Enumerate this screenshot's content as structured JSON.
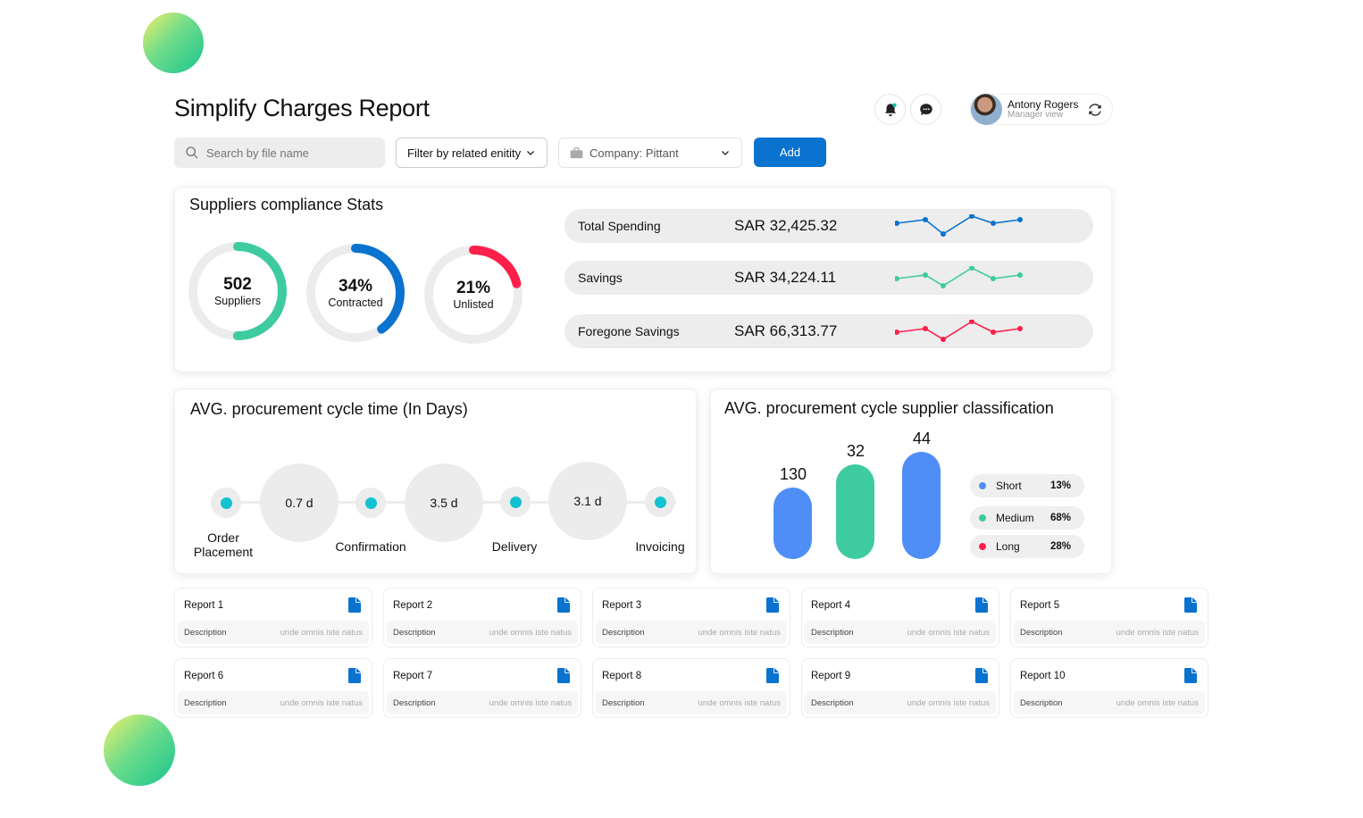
{
  "header": {
    "title": "Simplify Charges Report",
    "user_name": "Antony Rogers",
    "user_role": "Manager view",
    "notification_badge_color": "#13c3a6"
  },
  "filters": {
    "search_placeholder": "Search by file name",
    "entity_filter": "Filter by related enitity",
    "company": "Company: Pittant",
    "add_label": "Add"
  },
  "compliance": {
    "title": "Suppliers compliance Stats",
    "gauges": [
      {
        "value": "502",
        "label": "Suppliers",
        "fill": 0.5,
        "color": "#3ecba0"
      },
      {
        "value": "34%",
        "label": "Contracted",
        "fill": 0.4,
        "color": "#0a72cf"
      },
      {
        "value": "21%",
        "label": "Unlisted",
        "fill": 0.21,
        "color": "#ff1f4b"
      }
    ],
    "stats": [
      {
        "label": "Total Spending",
        "value": "SAR 32,425.32",
        "color": "#0a72cf",
        "trend": [
          3,
          4,
          0,
          5,
          3,
          4
        ]
      },
      {
        "label": "Savings",
        "value": "SAR 34,224.11",
        "color": "#3ecba0",
        "trend": [
          2,
          3,
          0,
          5,
          2,
          3
        ]
      },
      {
        "label": "Foregone Savings",
        "value": "SAR 66,313.77",
        "color": "#ff1f4b",
        "trend": [
          2,
          3,
          0,
          5,
          2,
          3
        ]
      }
    ]
  },
  "cycle": {
    "title": "AVG. procurement cycle time (In Days)",
    "durations": [
      "0.7 d",
      "3.5 d",
      "3.1 d"
    ],
    "stages": [
      "Order Placement",
      "Confirmation",
      "Delivery",
      "Invoicing"
    ]
  },
  "classification": {
    "title": "AVG. procurement cycle supplier classification",
    "bars": [
      {
        "value": "130",
        "color": "#4f8ef7"
      },
      {
        "value": "32",
        "color": "#3ecba0"
      },
      {
        "value": "44",
        "color": "#4f8ef7"
      }
    ],
    "legend": [
      {
        "label": "Short",
        "pct": "13%",
        "color": "#4f8ef7"
      },
      {
        "label": "Medium",
        "pct": "68%",
        "color": "#3ecba0"
      },
      {
        "label": "Long",
        "pct": "28%",
        "color": "#ff1f4b"
      }
    ]
  },
  "reports": [
    {
      "title": "Report 1",
      "desc_label": "Description",
      "desc": "unde omnis iste natus"
    },
    {
      "title": "Report 2",
      "desc_label": "Description",
      "desc": "unde omnis iste natus"
    },
    {
      "title": "Report 3",
      "desc_label": "Description",
      "desc": "unde omnis iste natus"
    },
    {
      "title": "Report 4",
      "desc_label": "Description",
      "desc": "unde omnis iste natus"
    },
    {
      "title": "Report 5",
      "desc_label": "Description",
      "desc": "unde omnis iste natus"
    },
    {
      "title": "Report 6",
      "desc_label": "Description",
      "desc": "unde omnis iste natus"
    },
    {
      "title": "Report 7",
      "desc_label": "Description",
      "desc": "unde omnis iste natus"
    },
    {
      "title": "Report 8",
      "desc_label": "Description",
      "desc": "unde omnis iste natus"
    },
    {
      "title": "Report 9",
      "desc_label": "Description",
      "desc": "unde omnis iste natus"
    },
    {
      "title": "Report 10",
      "desc_label": "Description",
      "desc": "unde omnis iste natus"
    }
  ]
}
